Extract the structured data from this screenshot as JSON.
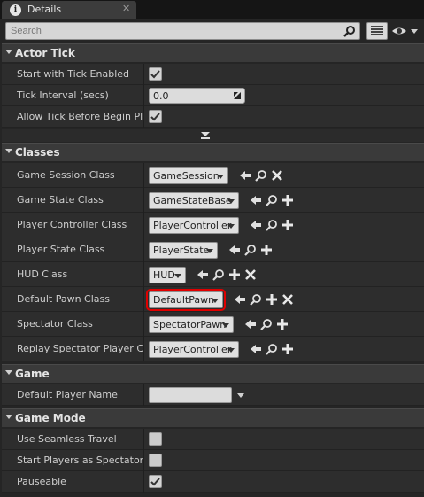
{
  "tab": {
    "icon": "info-icon",
    "label": "Details",
    "close": "✕"
  },
  "search": {
    "placeholder": "Search",
    "value": ""
  },
  "sections": {
    "actor_tick": "Actor Tick",
    "classes": "Classes",
    "game": "Game",
    "game_mode": "Game Mode"
  },
  "actor_tick": {
    "start_with_tick": {
      "label": "Start with Tick Enabled",
      "checked": true
    },
    "tick_interval": {
      "label": "Tick Interval (secs)",
      "value": "0.0"
    },
    "allow_tick": {
      "label": "Allow Tick Before Begin Play",
      "checked": true
    }
  },
  "classes": [
    {
      "label": "Game Session Class",
      "value": "GameSession",
      "actions": [
        "back-arrow-icon",
        "browse-icon",
        "clear-icon"
      ]
    },
    {
      "label": "Game State Class",
      "value": "GameStateBase",
      "actions": [
        "back-arrow-icon",
        "browse-icon",
        "add-icon"
      ]
    },
    {
      "label": "Player Controller Class",
      "value": "PlayerController",
      "actions": [
        "back-arrow-icon",
        "browse-icon",
        "add-icon"
      ]
    },
    {
      "label": "Player State Class",
      "value": "PlayerState",
      "actions": [
        "back-arrow-icon",
        "browse-icon",
        "add-icon"
      ]
    },
    {
      "label": "HUD Class",
      "value": "HUD",
      "actions": [
        "back-arrow-icon",
        "browse-icon",
        "add-icon",
        "clear-icon"
      ]
    },
    {
      "label": "Default Pawn Class",
      "value": "DefaultPawn",
      "highlighted": true,
      "actions": [
        "back-arrow-icon",
        "browse-icon",
        "add-icon",
        "clear-icon"
      ]
    },
    {
      "label": "Spectator Class",
      "value": "SpectatorPawn",
      "actions": [
        "back-arrow-icon",
        "browse-icon",
        "add-icon"
      ]
    },
    {
      "label": "Replay Spectator Player Controller Class",
      "value": "PlayerController",
      "actions": [
        "back-arrow-icon",
        "browse-icon",
        "add-icon"
      ]
    }
  ],
  "game": {
    "default_player_name": {
      "label": "Default Player Name",
      "value": ""
    }
  },
  "game_mode": {
    "use_seamless_travel": {
      "label": "Use Seamless Travel",
      "checked": false
    },
    "start_as_spectators": {
      "label": "Start Players as Spectators",
      "checked": false
    },
    "pauseable": {
      "label": "Pauseable",
      "checked": true
    }
  },
  "colors": {
    "highlight": "#e00000",
    "panel": "#252525",
    "row": "#2d2d2d",
    "section": "#3a3a3a"
  }
}
